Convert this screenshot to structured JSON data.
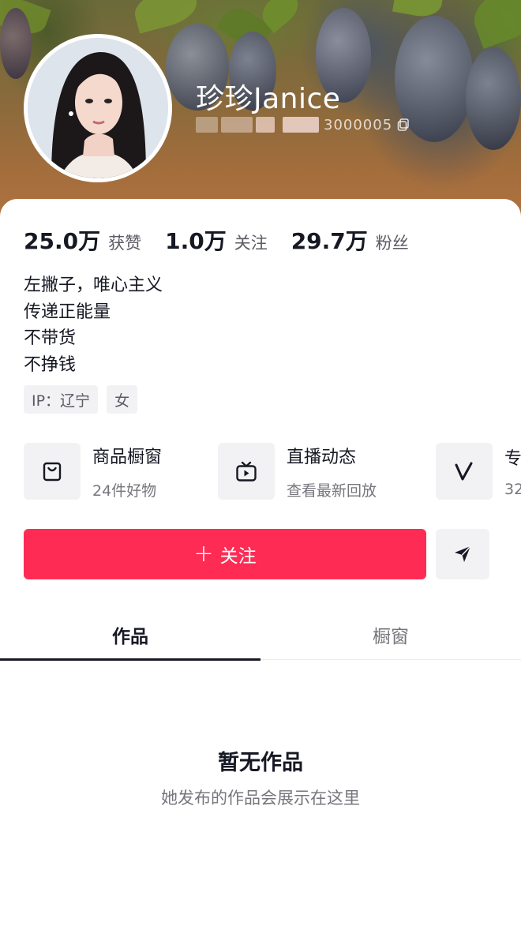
{
  "profile": {
    "username": "珍珍Janice",
    "user_id_visible": "3000005"
  },
  "stats": [
    {
      "value": "25.0万",
      "label": "获赞"
    },
    {
      "value": "1.0万",
      "label": "关注"
    },
    {
      "value": "29.7万",
      "label": "粉丝"
    }
  ],
  "bio": [
    "左撇子，唯心主义",
    "传递正能量",
    "不带货",
    "不挣钱"
  ],
  "tags": [
    "IP：辽宁",
    "女"
  ],
  "features": [
    {
      "title": "商品橱窗",
      "subtitle": "24件好物",
      "icon": "shopping-bag-icon"
    },
    {
      "title": "直播动态",
      "subtitle": "查看最新回放",
      "icon": "tv-play-icon"
    },
    {
      "title": "专",
      "subtitle": "32",
      "icon": "v-logo-icon"
    }
  ],
  "actions": {
    "follow_label": "关注",
    "share_icon": "send-icon"
  },
  "tabs": [
    "作品",
    "橱窗"
  ],
  "empty": {
    "title": "暂无作品",
    "subtitle": "她发布的作品会展示在这里"
  },
  "colors": {
    "accent": "#fe2c55",
    "text": "#161823",
    "muted": "#75767c",
    "chip_bg": "#f2f2f4"
  }
}
